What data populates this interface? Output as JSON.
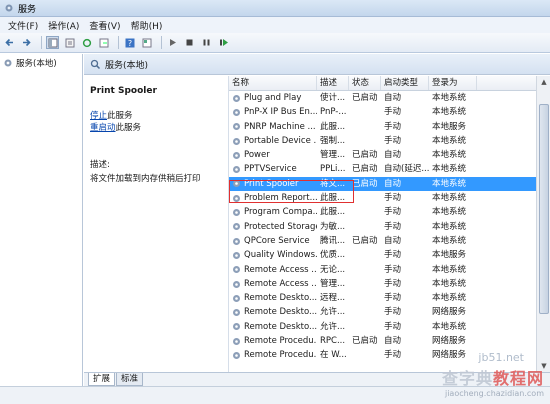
{
  "window": {
    "title": "服务"
  },
  "menu": [
    "文件(F)",
    "操作(A)",
    "查看(V)",
    "帮助(H)"
  ],
  "tree": {
    "root_label": "服务(本地)"
  },
  "header": {
    "label": "服务(本地)"
  },
  "detail": {
    "service_name": "Print Spooler",
    "stop_link": "停止",
    "stop_suffix": "此服务",
    "restart_link": "重启动",
    "restart_suffix": "此服务",
    "desc_label": "描述:",
    "desc_text": "将文件加载到内存供稍后打印"
  },
  "columns": [
    "名称",
    "描述",
    "状态",
    "启动类型",
    "登录为"
  ],
  "rows": [
    [
      "Plug and Play",
      "使计...",
      "已启动",
      "自动",
      "本地系统"
    ],
    [
      "PnP-X IP Bus En...",
      "PnP-...",
      "",
      "手动",
      "本地系统"
    ],
    [
      "PNRP Machine ...",
      "此服...",
      "",
      "手动",
      "本地服务"
    ],
    [
      "Portable Device ...",
      "强制...",
      "",
      "手动",
      "本地系统"
    ],
    [
      "Power",
      "管理...",
      "已启动",
      "自动",
      "本地系统"
    ],
    [
      "PPTVService",
      "PPLi...",
      "已启动",
      "自动(延迟...",
      "本地系统"
    ],
    [
      "Print Spooler",
      "将文...",
      "已启动",
      "自动",
      "本地系统"
    ],
    [
      "Problem Report...",
      "此服...",
      "",
      "手动",
      "本地系统"
    ],
    [
      "Program Compa...",
      "此服...",
      "",
      "手动",
      "本地系统"
    ],
    [
      "Protected Storage",
      "为敏...",
      "",
      "手动",
      "本地系统"
    ],
    [
      "QPCore Service",
      "腾讯...",
      "已启动",
      "自动",
      "本地系统"
    ],
    [
      "Quality Windows...",
      "优质...",
      "",
      "手动",
      "本地服务"
    ],
    [
      "Remote Access ...",
      "无论...",
      "",
      "手动",
      "本地系统"
    ],
    [
      "Remote Access ...",
      "管理...",
      "",
      "手动",
      "本地系统"
    ],
    [
      "Remote Deskto...",
      "远程...",
      "",
      "手动",
      "本地系统"
    ],
    [
      "Remote Deskto...",
      "允许...",
      "",
      "手动",
      "网络服务"
    ],
    [
      "Remote Deskto...",
      "允许...",
      "",
      "手动",
      "本地系统"
    ],
    [
      "Remote Procedu...",
      "RPC...",
      "已启动",
      "自动",
      "网络服务"
    ],
    [
      "Remote Procedu...",
      "在 W...",
      "",
      "手动",
      "网络服务"
    ]
  ],
  "selected_row": 6,
  "tabs": [
    "扩展",
    "标准"
  ],
  "watermark": {
    "site": "jb51.net",
    "brand_a": "查字典",
    "brand_b": "教程网",
    "url": "jiaocheng.chazidian.com"
  },
  "colors": {
    "selection": "#3399ff",
    "highlight_box": "#e03030",
    "link": "#0645ad"
  }
}
